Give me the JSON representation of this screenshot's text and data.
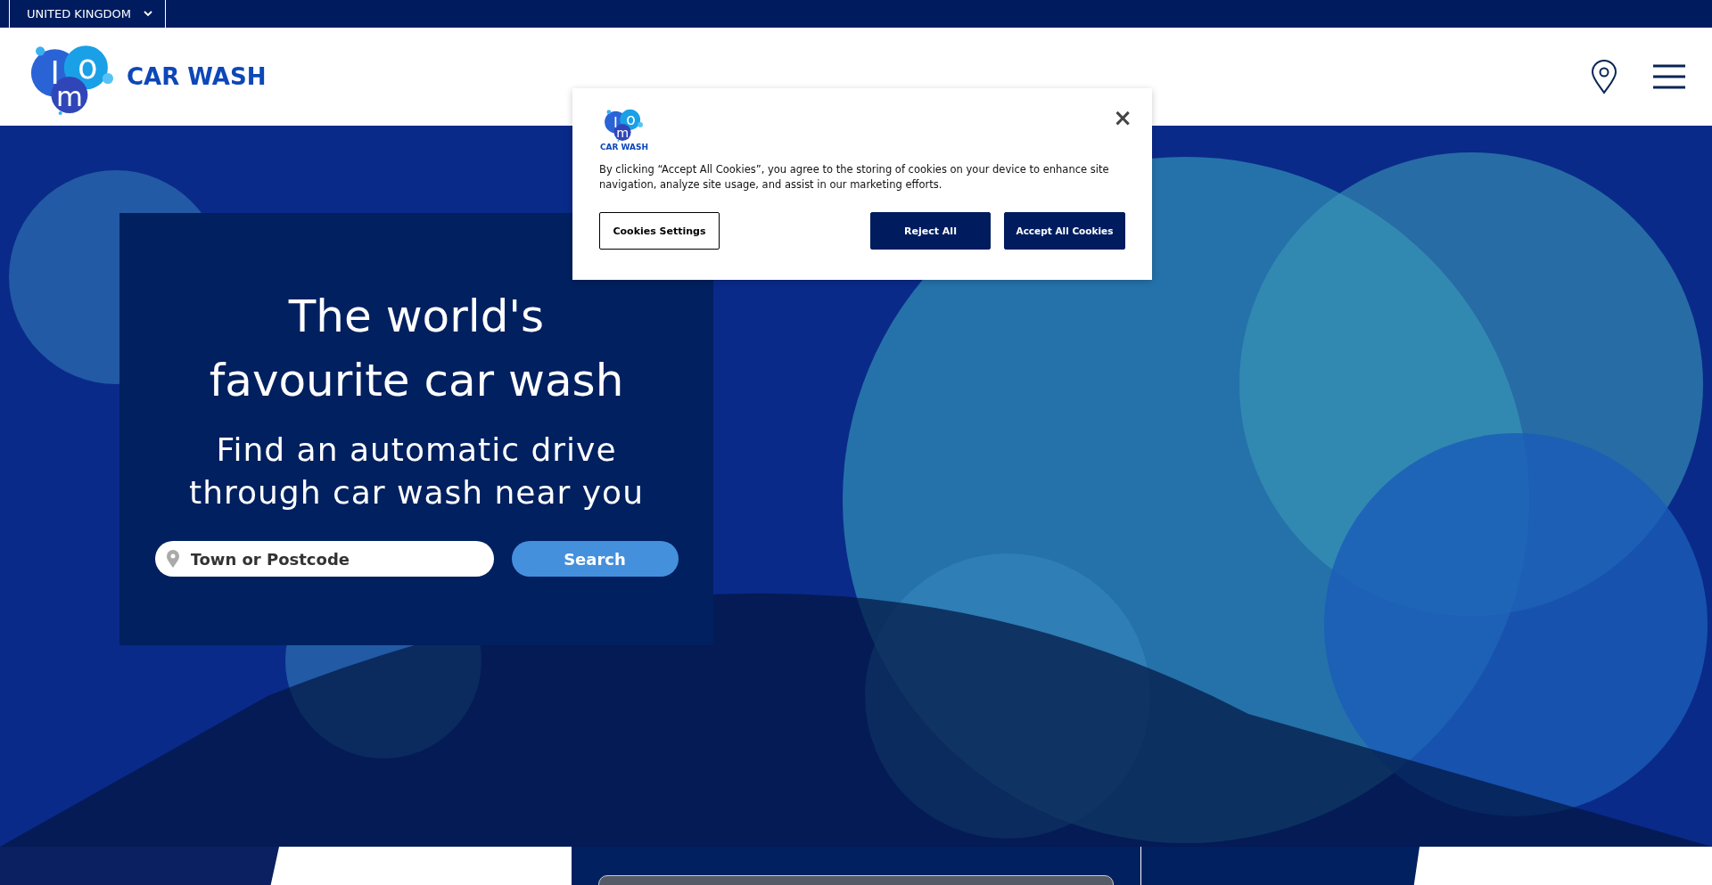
{
  "top_bar": {
    "country": "UNITED KINGDOM"
  },
  "header": {
    "logo_letters": "Imo",
    "logo_text": "CAR WASH"
  },
  "hero": {
    "title": "The world's favourite car wash",
    "subtitle": "Find an automatic drive through car wash near you",
    "search": {
      "placeholder": "Town or Postcode"
    },
    "search_button": "Search"
  },
  "cookie_dialog": {
    "logo_letters": "Imo",
    "logo_text": "CAR WASH",
    "message": "By clicking “Accept All Cookies”, you agree to the storing of cookies on your device to enhance site navigation, analyze site usage, and assist in our marketing efforts.",
    "close": "×",
    "buttons": [
      {
        "label": "Cookies Settings",
        "kind": "outline"
      },
      {
        "label": "Reject All",
        "kind": "filled"
      },
      {
        "label": "Accept All Cookies",
        "kind": "filled"
      }
    ]
  }
}
